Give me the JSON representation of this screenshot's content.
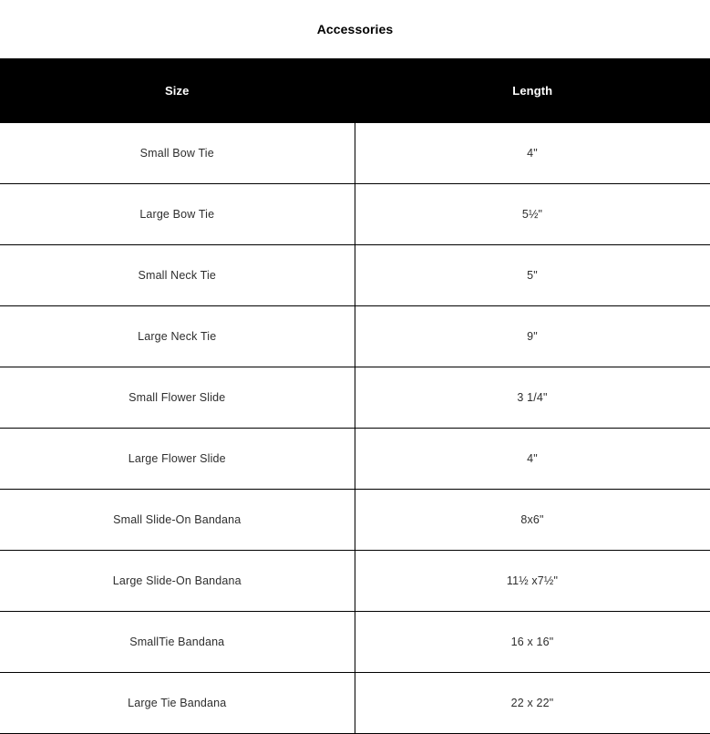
{
  "page": {
    "title": "Accessories"
  },
  "table": {
    "columns": [
      {
        "key": "size",
        "label": "Size"
      },
      {
        "key": "length",
        "label": "Length"
      }
    ],
    "rows": [
      {
        "size": "Small Bow Tie",
        "length": "4\""
      },
      {
        "size": "Large Bow Tie",
        "length": "5½\""
      },
      {
        "size": "Small Neck Tie",
        "length": "5\""
      },
      {
        "size": "Large Neck Tie",
        "length": "9\""
      },
      {
        "size": "Small Flower Slide",
        "length": "3 1/4\""
      },
      {
        "size": "Large Flower Slide",
        "length": "4\""
      },
      {
        "size": "Small Slide-On Bandana",
        "length": "8x6\""
      },
      {
        "size": "Large Slide-On Bandana",
        "length": "11½ x7½\""
      },
      {
        "size": "SmallTie Bandana",
        "length": "16 x 16\""
      },
      {
        "size": "Large Tie Bandana",
        "length": "22 x 22\""
      }
    ]
  },
  "colors": {
    "header_background": "#000000",
    "header_text": "#ffffff",
    "body_text": "#2e2e2e",
    "border": "#000000",
    "page_background": "#ffffff"
  }
}
